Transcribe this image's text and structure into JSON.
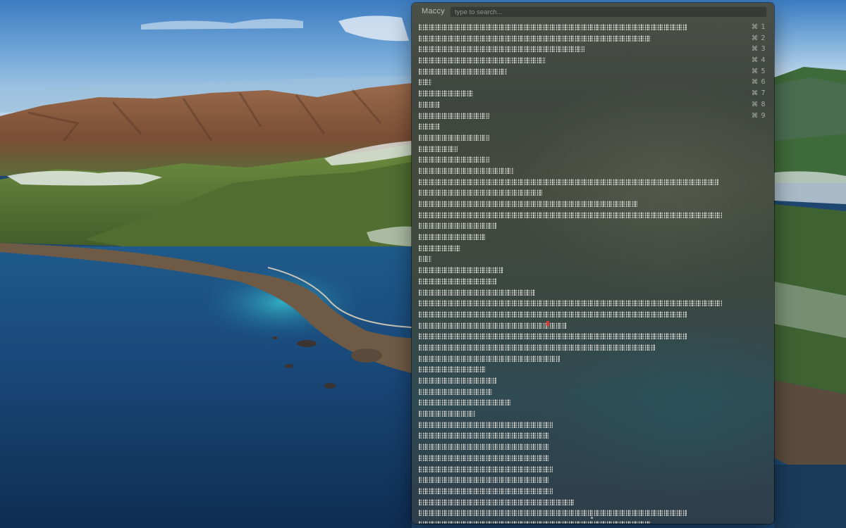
{
  "desktop": {
    "wallpaper": "macos-big-sur-coastline",
    "colors": {
      "sky_top": "#3f7fc4",
      "sky_horizon": "#b9d3ea",
      "ocean_deep": "#163a63",
      "ocean_shallow": "#2aa5c0",
      "hills_green": "#5d7d3a",
      "mountains_brown": "#8b5a3c"
    }
  },
  "maccy": {
    "app_title": "Maccy",
    "search": {
      "placeholder": "type to search...",
      "value": ""
    },
    "accent_color": "#d9382f",
    "items": [
      {
        "text": "obscured clipboard entry",
        "shortcut": "⌘ 1"
      },
      {
        "text": "obscured clipboard entry",
        "shortcut": "⌘ 2"
      },
      {
        "text": "obscured clipboard entry",
        "shortcut": "⌘ 3"
      },
      {
        "text": "obscured clipboard entry",
        "shortcut": "⌘ 4"
      },
      {
        "text": "obscured clipboard entry",
        "shortcut": "⌘ 5"
      },
      {
        "text": "obscured clipboard entry",
        "shortcut": "⌘ 6"
      },
      {
        "text": "obscured clipboard entry",
        "shortcut": "⌘ 7"
      },
      {
        "text": "obscured clipboard entry",
        "shortcut": "⌘ 8"
      },
      {
        "text": "obscured clipboard entry",
        "shortcut": "⌘ 9"
      },
      {
        "text": "obscured clipboard entry",
        "shortcut": ""
      },
      {
        "text": "obscured clipboard entry",
        "shortcut": ""
      },
      {
        "text": "obscured clipboard entry",
        "shortcut": ""
      },
      {
        "text": "obscured clipboard entry",
        "shortcut": ""
      },
      {
        "text": "obscured clipboard entry",
        "shortcut": ""
      },
      {
        "text": "obscured clipboard entry",
        "shortcut": ""
      },
      {
        "text": "obscured clipboard entry",
        "shortcut": ""
      },
      {
        "text": "obscured clipboard entry",
        "shortcut": ""
      },
      {
        "text": "obscured clipboard entry",
        "shortcut": ""
      },
      {
        "text": "obscured clipboard entry",
        "shortcut": ""
      },
      {
        "text": "obscured clipboard entry",
        "shortcut": ""
      },
      {
        "text": "obscured clipboard entry",
        "shortcut": ""
      },
      {
        "text": "obscured clipboard entry",
        "shortcut": ""
      },
      {
        "text": "obscured clipboard entry",
        "shortcut": ""
      },
      {
        "text": "obscured clipboard entry",
        "shortcut": ""
      },
      {
        "text": "obscured clipboard entry",
        "shortcut": ""
      },
      {
        "text": "obscured clipboard entry",
        "shortcut": ""
      },
      {
        "text": "obscured clipboard entry",
        "shortcut": ""
      },
      {
        "text": "obscured clipboard entry",
        "shortcut": ""
      },
      {
        "text": "obscured clipboard entry",
        "shortcut": ""
      },
      {
        "text": "obscured clipboard entry",
        "shortcut": ""
      },
      {
        "text": "obscured clipboard entry",
        "shortcut": ""
      },
      {
        "text": "obscured clipboard entry",
        "shortcut": ""
      },
      {
        "text": "obscured clipboard entry",
        "shortcut": ""
      },
      {
        "text": "obscured clipboard entry",
        "shortcut": ""
      },
      {
        "text": "obscured clipboard entry",
        "shortcut": ""
      },
      {
        "text": "obscured clipboard entry",
        "shortcut": ""
      },
      {
        "text": "obscured clipboard entry",
        "shortcut": ""
      },
      {
        "text": "obscured clipboard entry",
        "shortcut": ""
      },
      {
        "text": "obscured clipboard entry",
        "shortcut": ""
      },
      {
        "text": "obscured clipboard entry",
        "shortcut": ""
      },
      {
        "text": "obscured clipboard entry",
        "shortcut": ""
      },
      {
        "text": "obscured clipboard entry",
        "shortcut": ""
      },
      {
        "text": "obscured clipboard entry",
        "shortcut": ""
      },
      {
        "text": "obscured clipboard entry",
        "shortcut": ""
      },
      {
        "text": "obscured clipboard entry",
        "shortcut": ""
      },
      {
        "text": "obscured clipboard entry",
        "shortcut": ""
      }
    ]
  }
}
